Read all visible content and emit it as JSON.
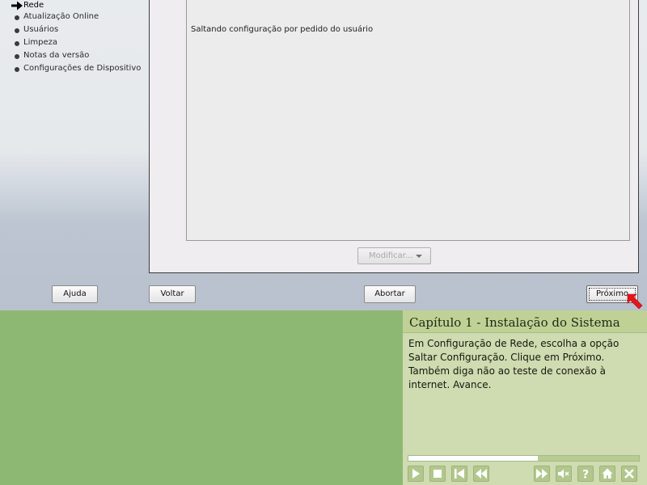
{
  "sidebar": {
    "items": [
      {
        "label": "Rede",
        "current": true
      },
      {
        "label": "Atualização Online"
      },
      {
        "label": "Usuários"
      },
      {
        "label": "Limpeza"
      },
      {
        "label": "Notas da versão"
      },
      {
        "label": "Configurações de Dispositivo"
      }
    ]
  },
  "main": {
    "status_message": "Saltando configuração por pedido do usuário",
    "modify_button": "Modificar..."
  },
  "buttons": {
    "help": "Ajuda",
    "back": "Voltar",
    "abort": "Abortar",
    "next": "Próximo"
  },
  "tutorial": {
    "title": "Capítulo 1 - Instalação do Sistema",
    "body": "Em Configuração de Rede, escolha a opção Saltar Configuração. Clique em Próximo. Também diga não ao teste de conexão à internet. Avance.",
    "progress": 0.56,
    "controls": [
      "play-icon",
      "stop-icon",
      "skip-to-start-icon",
      "rewind-icon",
      "fast-forward-icon",
      "mute-icon",
      "help-icon",
      "home-icon",
      "close-icon"
    ]
  },
  "colors": {
    "tutorial_background": "#8db873",
    "tutorial_panel": "#cfdbb0",
    "pointer_arrow": "#e8141b"
  }
}
